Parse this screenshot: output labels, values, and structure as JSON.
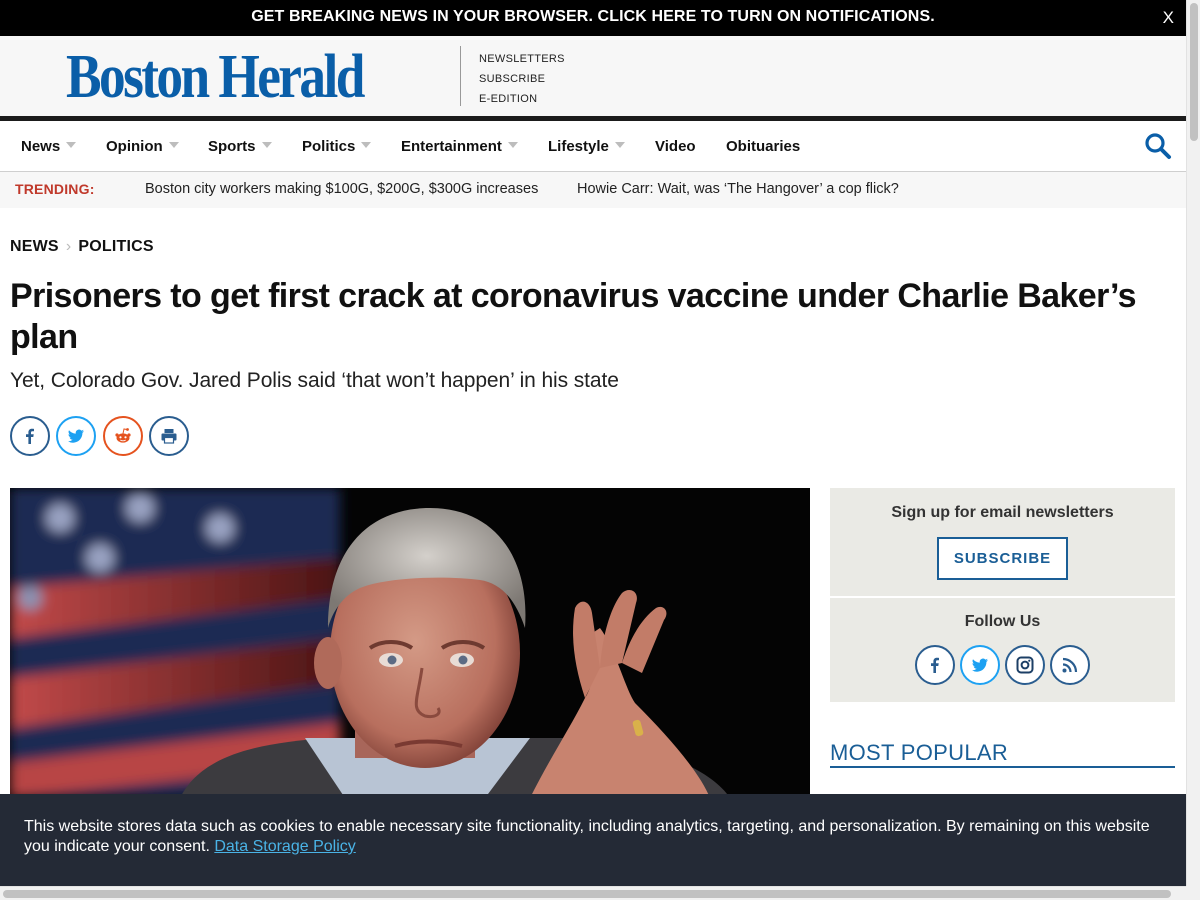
{
  "notification": {
    "text": "GET BREAKING NEWS IN YOUR BROWSER. CLICK HERE TO TURN ON NOTIFICATIONS.",
    "close": "X"
  },
  "masthead": {
    "logo": "Boston Herald",
    "links": [
      "NEWSLETTERS",
      "SUBSCRIBE",
      "E-EDITION"
    ]
  },
  "nav": {
    "items": [
      {
        "label": "News"
      },
      {
        "label": "Opinion"
      },
      {
        "label": "Sports"
      },
      {
        "label": "Politics"
      },
      {
        "label": "Entertainment"
      },
      {
        "label": "Lifestyle"
      },
      {
        "label": "Video"
      },
      {
        "label": "Obituaries"
      }
    ]
  },
  "trending": {
    "label": "TRENDING:",
    "items": [
      "Boston city workers making $100G, $200G, $300G increases",
      "Howie Carr: Wait, was ‘The Hangover’ a cop flick?"
    ]
  },
  "article": {
    "breadcrumb": [
      "NEWS",
      "POLITICS"
    ],
    "headline": "Prisoners to get first crack at coronavirus vaccine under Charlie Baker’s plan",
    "subhead": "Yet, Colorado Gov. Jared Polis said ‘that won’t happen’ in his state"
  },
  "share_icons": [
    "facebook-icon",
    "twitter-icon",
    "reddit-icon",
    "print-icon"
  ],
  "sidebar": {
    "newsletter_title": "Sign up for email newsletters",
    "subscribe_label": "SUBSCRIBE",
    "follow_title": "Follow Us",
    "follow_icons": [
      "facebook-icon",
      "twitter-icon",
      "instagram-icon",
      "rss-icon"
    ],
    "most_popular": "MOST POPULAR"
  },
  "cookie": {
    "text": "This website stores data such as cookies to enable necessary site functionality, including analytics, targeting, and personalization. By remaining on this website you indicate your consent.",
    "link": "Data Storage Policy"
  },
  "colors": {
    "brand_blue": "#0a5ea8",
    "trending_red": "#c0392b",
    "cookie_bg": "#242a36",
    "cookie_link": "#4ab3e6",
    "reddit_orange": "#e5531f",
    "twitter_blue": "#1da1f2"
  }
}
